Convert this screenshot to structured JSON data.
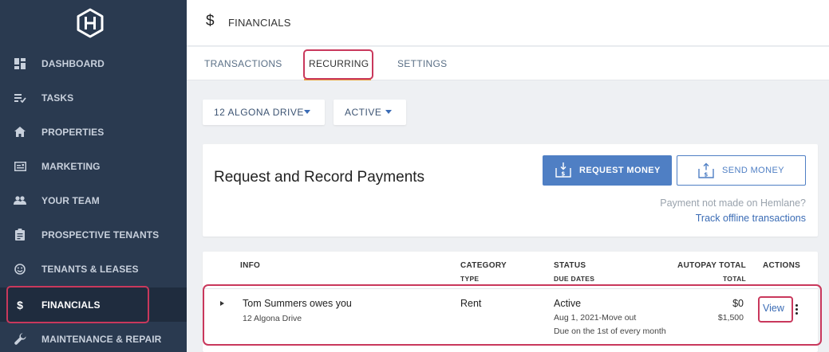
{
  "sidebar": {
    "items": [
      {
        "label": "DASHBOARD",
        "icon": "dashboard-icon"
      },
      {
        "label": "TASKS",
        "icon": "tasks-icon"
      },
      {
        "label": "PROPERTIES",
        "icon": "home-icon"
      },
      {
        "label": "MARKETING",
        "icon": "marketing-icon"
      },
      {
        "label": "YOUR TEAM",
        "icon": "team-icon"
      },
      {
        "label": "PROSPECTIVE TENANTS",
        "icon": "clipboard-icon"
      },
      {
        "label": "TENANTS & LEASES",
        "icon": "smiley-icon"
      },
      {
        "label": "FINANCIALS",
        "icon": "dollar-icon",
        "active": true
      },
      {
        "label": "MAINTENANCE & REPAIR",
        "icon": "wrench-icon"
      }
    ]
  },
  "header": {
    "icon": "$",
    "title": "FINANCIALS"
  },
  "tabs": [
    {
      "label": "TRANSACTIONS"
    },
    {
      "label": "RECURRING",
      "active": true
    },
    {
      "label": "SETTINGS"
    }
  ],
  "filters": {
    "property": "12 ALGONA DRIVE",
    "status": "ACTIVE"
  },
  "payments": {
    "heading": "Request and Record Payments",
    "request_button": "REQUEST MONEY",
    "send_button": "SEND MONEY",
    "note": "Payment not made on Hemlane?",
    "link": "Track offline transactions"
  },
  "table": {
    "headers": {
      "info": "INFO",
      "category": "CATEGORY",
      "category_sub": "TYPE",
      "status": "STATUS",
      "status_sub": "DUE DATES",
      "autopay": "AUTOPAY TOTAL",
      "autopay_sub": "TOTAL",
      "actions": "ACTIONS"
    },
    "rows": [
      {
        "info": "Tom Summers owes you",
        "info_sub": "12 Algona Drive",
        "category": "Rent",
        "status": "Active",
        "due_dates": "Aug 1, 2021-Move out",
        "due_note": "Due on the 1st of every month",
        "autopay": "$0",
        "total": "$1,500",
        "action": "View"
      }
    ]
  },
  "colors": {
    "sidebar_bg": "#2a3a50",
    "accent_blue": "#4f7fc4",
    "tab_underline": "#e9a23b",
    "highlight": "#c9385c"
  }
}
